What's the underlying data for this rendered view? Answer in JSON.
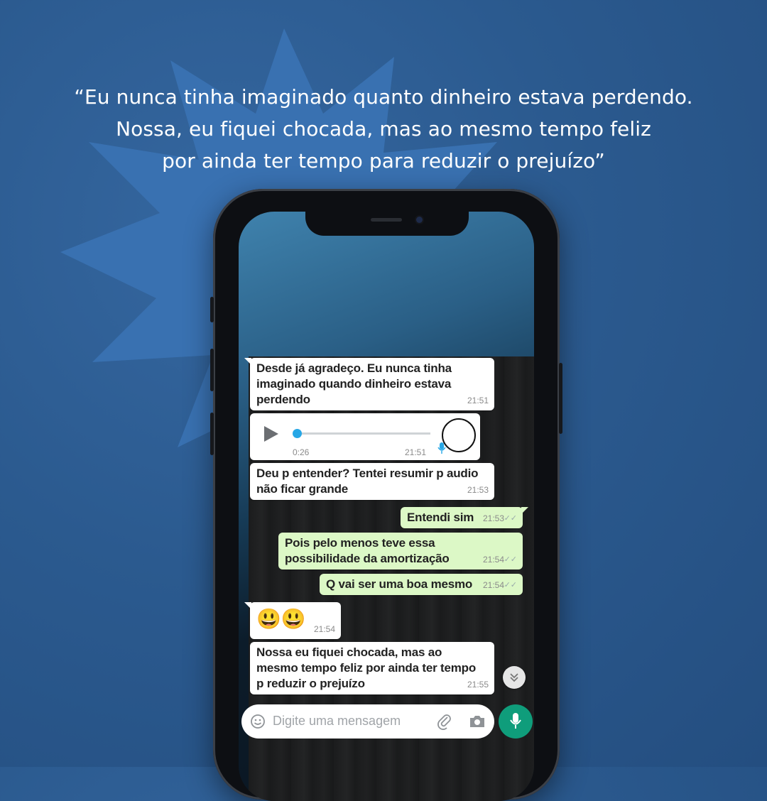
{
  "quote": {
    "line1": "“Eu nunca tinha imaginado quanto dinheiro estava perdendo.",
    "line2": "Nossa, eu fiquei chocada, mas ao mesmo tempo feliz",
    "line3": "por ainda ter tempo para reduzir o prejuízo”"
  },
  "chat": {
    "messages": [
      {
        "direction": "in",
        "lines": [
          "Desde já agradeço. Eu nunca tinha",
          "imaginado quando dinheiro estava",
          "perdendo"
        ],
        "time": "21:51"
      },
      {
        "direction": "in",
        "type": "audio",
        "duration": "0:26",
        "time": "21:51"
      },
      {
        "direction": "in",
        "lines": [
          "Deu p entender? Tentei resumir p audio",
          "não ficar grande"
        ],
        "time": "21:53"
      },
      {
        "direction": "out",
        "lines": [
          "Entendi sim"
        ],
        "time": "21:53",
        "ticks": "✓✓"
      },
      {
        "direction": "out",
        "lines": [
          "Pois pelo menos teve essa",
          "possibilidade da amortização"
        ],
        "time": "21:54",
        "ticks": "✓✓"
      },
      {
        "direction": "out",
        "lines": [
          "Q vai ser uma boa mesmo"
        ],
        "time": "21:54",
        "ticks": "✓✓"
      },
      {
        "direction": "in",
        "lines": [
          "😃😃"
        ],
        "time": "21:54"
      },
      {
        "direction": "in",
        "lines": [
          "Nossa eu fiquei chocada, mas ao",
          "mesmo tempo feliz por ainda ter tempo",
          "p reduzir o prejuízo"
        ],
        "time": "21:55"
      }
    ]
  },
  "composer": {
    "placeholder": "Digite uma mensagem",
    "icons": [
      "emoji-icon",
      "paperclip-icon",
      "camera-icon",
      "microphone-icon"
    ]
  },
  "colors": {
    "background": "#2b5a8f",
    "burst": "#3a72b2",
    "incoming_bubble": "#ffffff",
    "outgoing_bubble": "#dcf8c6",
    "mic_button": "#0f9d7b",
    "audio_accent": "#27a7e6"
  }
}
